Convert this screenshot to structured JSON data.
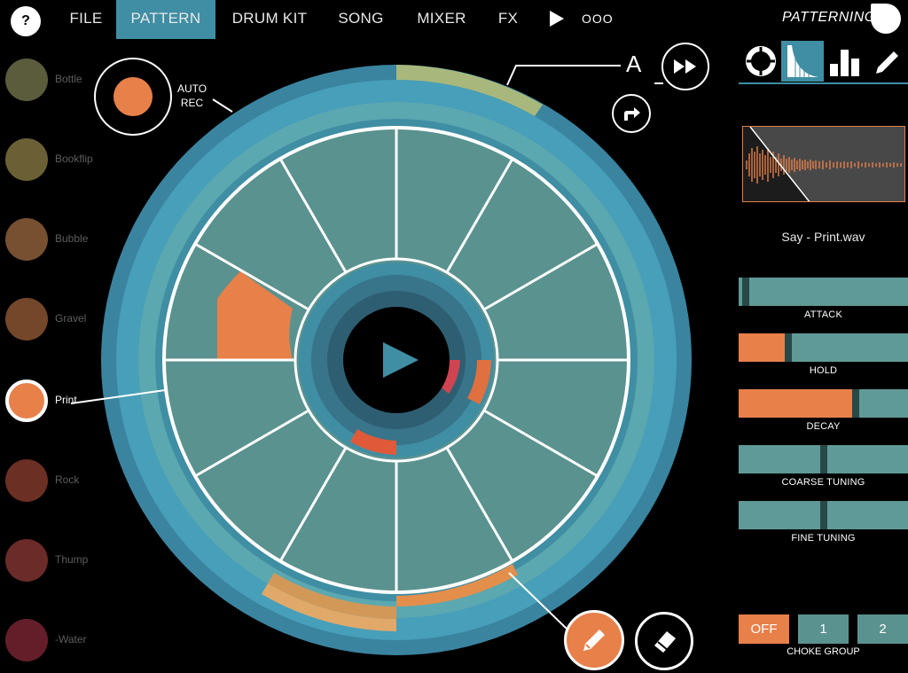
{
  "topbar": {
    "help": "?",
    "nav": [
      {
        "label": "FILE",
        "active": false
      },
      {
        "label": "PATTERN",
        "active": true
      },
      {
        "label": "DRUM KIT",
        "active": false
      },
      {
        "label": "SONG",
        "active": false
      },
      {
        "label": "MIXER",
        "active": false
      },
      {
        "label": "FX",
        "active": false
      }
    ],
    "dots": "OOO",
    "brand": "PATTERNING"
  },
  "sounds": [
    {
      "label": "Bottle",
      "color": "#5a5c3c"
    },
    {
      "label": "Bookflip",
      "color": "#6b6035"
    },
    {
      "label": "Bubble",
      "color": "#765031"
    },
    {
      "label": "Gravel",
      "color": "#74472a"
    },
    {
      "label": "Print",
      "color": "#e8804a",
      "selected": true
    },
    {
      "label": "Rock",
      "color": "#6b2f24"
    },
    {
      "label": "Thump",
      "color": "#6b2b28"
    },
    {
      "label": "-Water",
      "color": "#641e2a"
    }
  ],
  "auto_rec": {
    "label_line1": "AUTO",
    "label_line2": "REC"
  },
  "pattern": {
    "letter": "A"
  },
  "colors": {
    "accent": "#3f8ea3",
    "orange": "#e8804a",
    "step": "#5a928f",
    "red": "#d6503a"
  },
  "right_panel": {
    "tabs": [
      "lifebuoy-icon",
      "envelope-icon",
      "bars-icon",
      "pencil-icon"
    ],
    "sample_name": "Say - Print.wav",
    "params": [
      {
        "label": "ATTACK",
        "fill": 0.0,
        "handle": 0.02
      },
      {
        "label": "HOLD",
        "fill": 0.27,
        "handle": 0.27
      },
      {
        "label": "DECAY",
        "fill": 0.67,
        "handle": 0.67
      },
      {
        "label": "COARSE TUNING",
        "fill": 0.0,
        "handle": 0.48
      },
      {
        "label": "FINE TUNING",
        "fill": 0.0,
        "handle": 0.48
      }
    ],
    "choke": {
      "off": "OFF",
      "one": "1",
      "two": "2",
      "label": "CHOKE GROUP"
    }
  }
}
